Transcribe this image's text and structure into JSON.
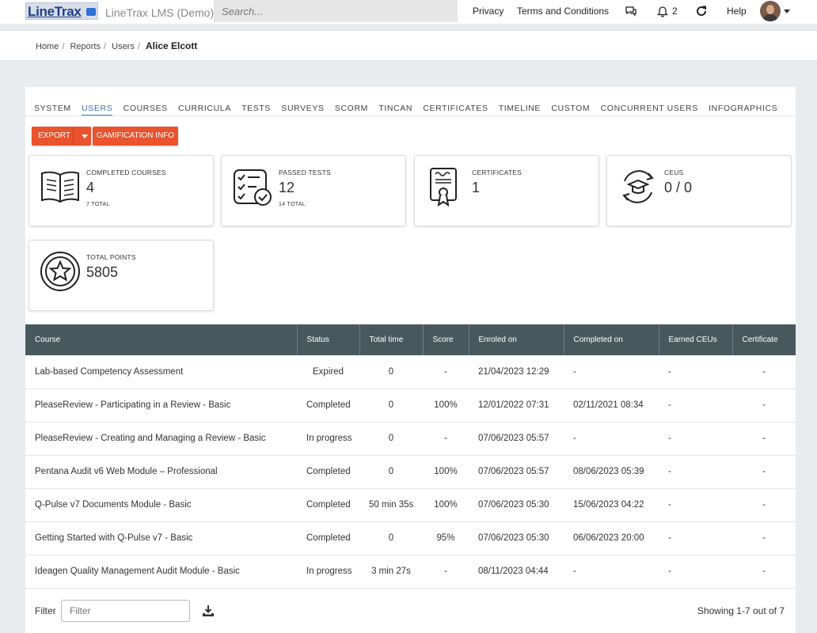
{
  "header": {
    "logo_text": "LineTrax",
    "app_title": "LineTrax LMS (Demo)",
    "search_placeholder": "Search...",
    "links": {
      "privacy": "Privacy",
      "terms": "Terms and Conditions",
      "help": "Help"
    },
    "notification_count": "2"
  },
  "breadcrumb": {
    "home": "Home",
    "reports": "Reports",
    "users": "Users",
    "current": "Alice Elcott"
  },
  "tabs": [
    "SYSTEM",
    "USERS",
    "COURSES",
    "CURRICULA",
    "TESTS",
    "SURVEYS",
    "SCORM",
    "TINCAN",
    "CERTIFICATES",
    "TIMELINE",
    "CUSTOM",
    "CONCURRENT USERS",
    "INFOGRAPHICS"
  ],
  "active_tab": "USERS",
  "buttons": {
    "export": "EXPORT",
    "gamification": "GAMIFICATION INFO"
  },
  "stats": {
    "completed_courses": {
      "label": "COMPLETED COURSES",
      "value": "4",
      "sub": "7 TOTAL"
    },
    "passed_tests": {
      "label": "PASSED TESTS",
      "value": "12",
      "sub": "14 TOTAL"
    },
    "certificates": {
      "label": "CERTIFICATES",
      "value": "1"
    },
    "ceus": {
      "label": "CEUS",
      "value": "0 / 0"
    },
    "total_points": {
      "label": "TOTAL POINTS",
      "value": "5805"
    }
  },
  "table": {
    "headers": [
      "Course",
      "Status",
      "Total time",
      "Score",
      "Enroled on",
      "Completed on",
      "Earned CEUs",
      "Certificate"
    ],
    "rows": [
      [
        "Lab-based Competency Assessment",
        "Expired",
        "0",
        "-",
        "21/04/2023 12:29",
        "-",
        "-",
        "-"
      ],
      [
        "PleaseReview - Participating in a Review - Basic",
        "Completed",
        "0",
        "100%",
        "12/01/2022 07:31",
        "02/11/2021 08:34",
        "-",
        "-"
      ],
      [
        "PleaseReview - Creating and Managing a Review - Basic",
        "In progress",
        "0",
        "-",
        "07/06/2023 05:57",
        "-",
        "-",
        "-"
      ],
      [
        "Pentana Audit v6 Web Module – Professional",
        "Completed",
        "0",
        "100%",
        "07/06/2023 05:57",
        "08/06/2023 05:39",
        "-",
        "-"
      ],
      [
        "Q-Pulse v7 Documents Module - Basic",
        "Completed",
        "50 min 35s",
        "100%",
        "07/06/2023 05:30",
        "15/06/2023 04:22",
        "-",
        "-"
      ],
      [
        "Getting Started with Q-Pulse v7 - Basic",
        "Completed",
        "0",
        "95%",
        "07/06/2023 05:30",
        "06/06/2023 20:00",
        "-",
        "-"
      ],
      [
        "Ideagen Quality Management Audit Module - Basic",
        "In progress",
        "3 min 27s",
        "-",
        "08/11/2023 04:44",
        "-",
        "-",
        "-"
      ]
    ]
  },
  "footer": {
    "filter_label": "Filter",
    "filter_placeholder": "Filter",
    "showing": "Showing 1-7 out of 7"
  },
  "colors": {
    "accent": "#e9532d",
    "tab_active": "#3a76c4",
    "table_header": "#48595e"
  }
}
